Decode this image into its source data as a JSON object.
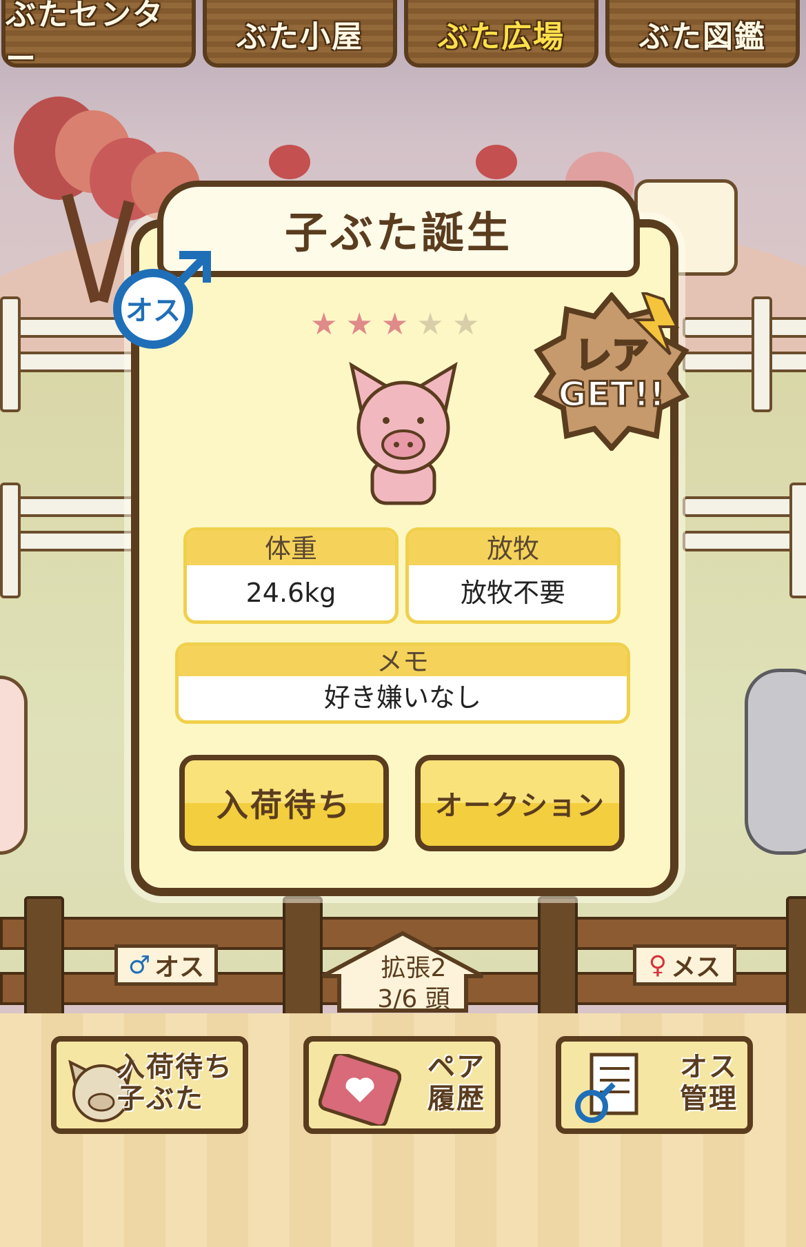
{
  "tabs": [
    {
      "label": "ぶたセンター",
      "active": false
    },
    {
      "label": "ぶた小屋",
      "active": false
    },
    {
      "label": "ぶた広場",
      "active": true
    },
    {
      "label": "ぶた図鑑",
      "active": false
    }
  ],
  "popup": {
    "title": "子ぶた誕生",
    "gender_badge": "オス",
    "rarity_stars_filled": 3,
    "rarity_stars_total": 5,
    "rare_badge": {
      "line1": "レア",
      "line2": "GET!!"
    },
    "weight_label": "体重",
    "weight_value": "24.6kg",
    "graze_label": "放牧",
    "graze_value": "放牧不要",
    "memo_label": "メモ",
    "memo_value": "好き嫌いなし",
    "btn_waiting": "入荷待ち",
    "btn_auction": "オークション"
  },
  "fence": {
    "male_sign": "オス",
    "female_sign": "メス",
    "expansion_label": "拡張2",
    "count_label": "3/6 頭"
  },
  "bottom": {
    "waiting_piglets": "入荷待ち\n子ぶた",
    "pair_history": "ペア\n履歴",
    "male_manage": "オス\n管理"
  },
  "colors": {
    "wood": "#5a3c1f",
    "active_tab": "#ffe04a",
    "male_blue": "#1f6fb8",
    "female_red": "#d8323c",
    "star_filled": "#e08a8a",
    "star_empty": "#d8cfa8"
  }
}
